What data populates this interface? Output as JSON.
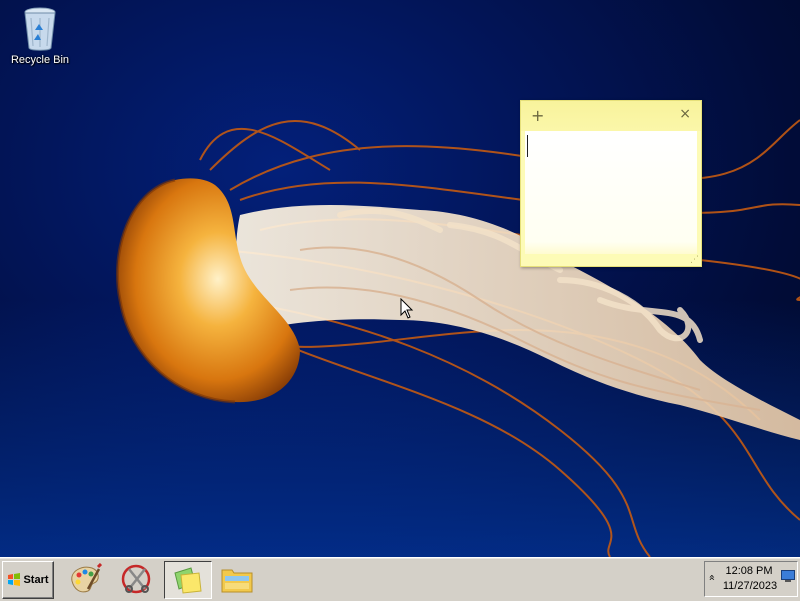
{
  "desktop": {
    "icons": [
      {
        "label": "Recycle Bin",
        "icon": "recycle-bin-icon"
      }
    ]
  },
  "sticky_note": {
    "add_symbol": "+",
    "close_symbol": "×",
    "text": ""
  },
  "taskbar": {
    "start_label": "Start",
    "apps": [
      {
        "name": "paint",
        "icon": "paint-palette-icon"
      },
      {
        "name": "snipping-tool",
        "icon": "scissors-icon"
      },
      {
        "name": "sticky-notes",
        "icon": "sticky-notes-icon",
        "active": true
      },
      {
        "name": "windows-explorer",
        "icon": "folder-icon"
      }
    ],
    "tray": {
      "expand_symbol": "»",
      "time": "12:08 PM",
      "date": "11/27/2023"
    }
  },
  "colors": {
    "taskbar_bg": "#d4d0c8",
    "sticky_bg": "#fdfbb6",
    "wallpaper_blue": "#0338a0",
    "jellyfish_orange": "#e88a1a"
  }
}
